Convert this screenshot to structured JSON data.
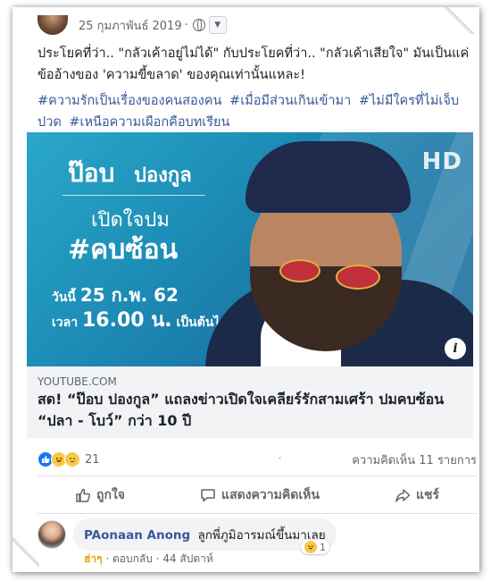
{
  "post": {
    "date": "25 กุมภาพันธ์ 2019",
    "separator": "·",
    "text": "ประโยคที่ว่า.. \"กลัวเค้าอยู่ไม่ได้\" กับประโยคที่ว่า.. \"กลัวเค้าเสียใจ\" มันเป็นแค่ข้ออ้างของ 'ความขี้ขลาด' ของคุณเท่านั้นแหละ!",
    "hashtags": [
      "#ความรักเป็นเรื่องของคนสองคน",
      "#เมื่อมีส่วนเกินเข้ามา",
      "#ไม่มีใครที่ไม่เจ็บปวด",
      "#เหนือความเผือกคือบทเรียน"
    ]
  },
  "media": {
    "brand": "HD",
    "name_first": "ป๊อบ",
    "name_last": "ปองกูล",
    "subtitle": "เปิดใจปม",
    "hashtag": "#คบซ้อน",
    "date_prefix": "วันนี้",
    "date_value": "25 ก.พ. 62",
    "time_prefix": "เวลา",
    "time_value": "16.00 น.",
    "time_suffix": "เป็นต้นไป",
    "info_symbol": "i"
  },
  "link": {
    "domain": "YOUTUBE.COM",
    "title": "สด! “ป๊อบ ปองกูล” แถลงข่าวเปิดใจเคลียร์รักสามเศร้า ปมคบซ้อน “ปลา - โบว์” กว่า 10 ปี"
  },
  "stats": {
    "reaction_count": "21",
    "comments": "ความคิดเห็น 11 รายการ",
    "dot": "."
  },
  "actions": {
    "like": "ถูกใจ",
    "comment": "แสดงความคิดเห็น",
    "share": "แชร์"
  },
  "comment": {
    "author": "PAonaan Anong",
    "text": "ลูกพี่ภูมิอารมณ์ขึ้นมาเลย",
    "reaction_count": "1",
    "reaction_label": "ฮ่าๆ",
    "reply": "ตอบกลับ",
    "time": "44 สัปดาห์",
    "meta_sep": "·"
  },
  "colors": {
    "link_blue": "#385898",
    "like_blue": "#1877f2",
    "haha_yellow": "#f7c948",
    "media_teal": "#1d8fb8"
  }
}
